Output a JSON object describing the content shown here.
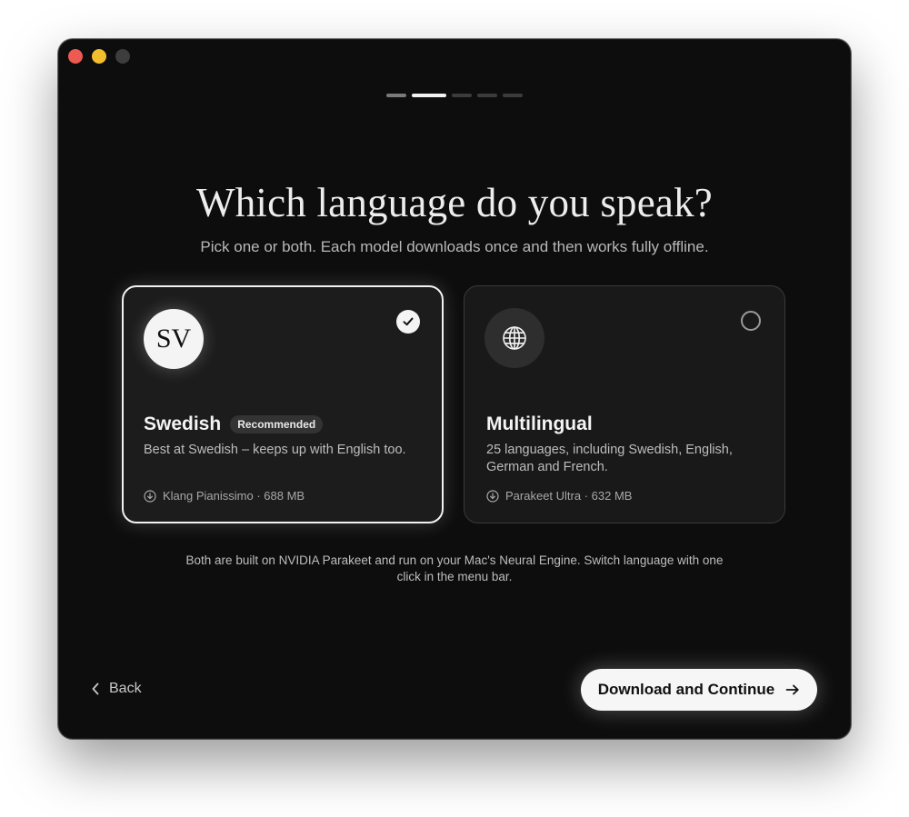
{
  "progress": {
    "total_steps": 5,
    "current_step": 2
  },
  "page": {
    "title": "Which language do you speak?",
    "subtitle": "Pick one or both. Each model downloads once and then works fully offline."
  },
  "cards": [
    {
      "avatar_text": "SV",
      "title": "Swedish",
      "badge": "Recommended",
      "description": "Best at Swedish – keeps up with English too.",
      "model": "Klang Pianissimo · 688 MB",
      "selected": true
    },
    {
      "avatar_icon": "globe-icon",
      "title": "Multilingual",
      "description": "25 languages, including Swedish, English, German and French.",
      "model": "Parakeet Ultra · 632 MB",
      "selected": false
    }
  ],
  "footnote": "Both are built on NVIDIA Parakeet and run on your Mac's Neural Engine. Switch language with one click in the menu bar.",
  "nav": {
    "back_label": "Back",
    "primary_label": "Download and Continue"
  }
}
